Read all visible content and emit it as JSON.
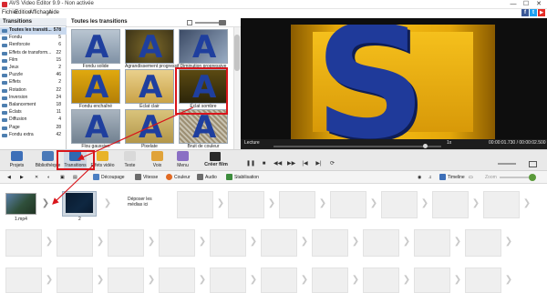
{
  "window": {
    "title": "AVS Video Editor 9.9 - Non activée",
    "min": "—",
    "max": "☐",
    "close": "✕"
  },
  "menu": [
    "Fichier",
    "Edition",
    "Affichage",
    "Aide"
  ],
  "social": {
    "facebook": "f",
    "twitter": "t",
    "youtube": "▶"
  },
  "categories": {
    "header": "Transitions",
    "items": [
      {
        "name": "Toutes les transiti...",
        "count": "578"
      },
      {
        "name": "Fondu",
        "count": "5"
      },
      {
        "name": "Renforcée",
        "count": "6"
      },
      {
        "name": "Effets de transform...",
        "count": "22"
      },
      {
        "name": "Film",
        "count": "15"
      },
      {
        "name": "Jeux",
        "count": "2"
      },
      {
        "name": "Puzzle",
        "count": "46"
      },
      {
        "name": "Effets",
        "count": "2"
      },
      {
        "name": "Rotation",
        "count": "22"
      },
      {
        "name": "Inversion",
        "count": "24"
      },
      {
        "name": "Balancement",
        "count": "18"
      },
      {
        "name": "Éclats",
        "count": "11"
      },
      {
        "name": "Diffusion",
        "count": "4"
      },
      {
        "name": "Page",
        "count": "28"
      },
      {
        "name": "Fondu extra",
        "count": "42"
      }
    ]
  },
  "gallery": {
    "title": "Toutes les transitions",
    "letter": "A",
    "tiles": [
      {
        "label": "Fondu solide"
      },
      {
        "label": "Agrandissement progressif"
      },
      {
        "label": "Diminution progressive"
      },
      {
        "label": "Fondu enchaîné"
      },
      {
        "label": "Éclat clair"
      },
      {
        "label": "Éclat sombre"
      },
      {
        "label": "Flou gaussien"
      },
      {
        "label": "Pixelate"
      },
      {
        "label": "Bruit de couleur"
      }
    ]
  },
  "preview": {
    "letter": "S",
    "label": "Lecture",
    "speed": "1x",
    "timecode": "00:00:01.730 / 00:00:02.500"
  },
  "toolbar": {
    "tools": [
      {
        "label": "Projets"
      },
      {
        "label": "Bibliothèque"
      },
      {
        "label": "Transitions"
      },
      {
        "label": "Effets vidéo"
      },
      {
        "label": "Texte"
      },
      {
        "label": "Voix"
      },
      {
        "label": "Menu"
      }
    ],
    "create": "Créer film",
    "controls": [
      "❚❚",
      "■",
      "◀◀",
      "▶▶",
      "|◀",
      "▶|",
      "⟳"
    ]
  },
  "editbar": {
    "decoupage": "Découpage",
    "vitesse": "Vitesse",
    "couleur": "Couleur",
    "audio": "Audio",
    "stabilisation": "Stabilisation",
    "timeline": "Timeline",
    "zoom": "Zoom"
  },
  "storyboard": {
    "clip1_label": "1.mp4",
    "clip2_label": "2",
    "drop_hint": "Déposer les médias ici"
  },
  "colors": {
    "accent_red": "#d9151b",
    "stage_yellow": "#d99a07",
    "letter_blue": "#1f3a9a"
  }
}
